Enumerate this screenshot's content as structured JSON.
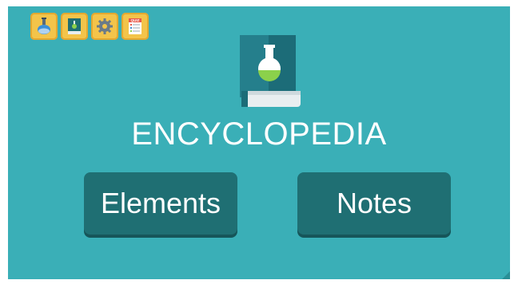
{
  "toolbar": {
    "items": [
      {
        "icon": "flask-icon"
      },
      {
        "icon": "encyclopedia-book-icon"
      },
      {
        "icon": "gear-icon"
      },
      {
        "icon": "quiz-clipboard-icon",
        "label": "QUIZ"
      }
    ]
  },
  "page": {
    "title": "ENCYCLOPEDIA"
  },
  "menu": {
    "elements_label": "Elements",
    "notes_label": "Notes"
  },
  "colors": {
    "background": "#3aafb7",
    "button": "#1f6f73",
    "toolbar_button": "#f3c44a",
    "text": "#ffffff"
  }
}
